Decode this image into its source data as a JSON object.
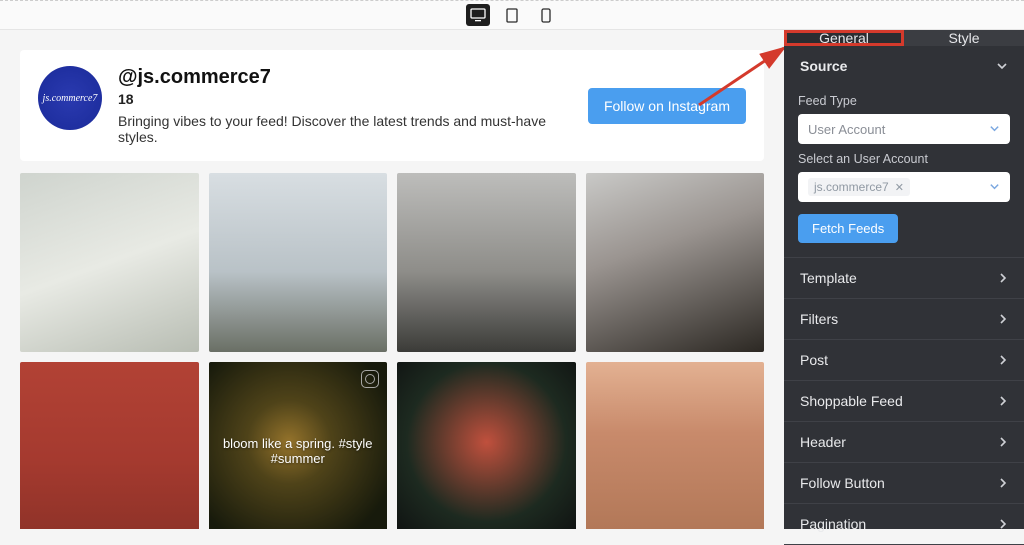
{
  "devices": [
    "desktop",
    "tablet",
    "mobile"
  ],
  "active_device": "desktop",
  "profile": {
    "avatar_text": "js.commerce7",
    "handle": "@js.commerce7",
    "posts_count": "18",
    "bio": "Bringing vibes to your feed! Discover the latest trends and must-have styles.",
    "follow_label": "Follow on Instagram"
  },
  "feed": {
    "items": [
      {
        "caption": ""
      },
      {
        "caption": ""
      },
      {
        "caption": ""
      },
      {
        "caption": ""
      },
      {
        "caption": ""
      },
      {
        "caption": "bloom like a spring. #style #summer",
        "show_icon": true
      },
      {
        "caption": ""
      },
      {
        "caption": ""
      }
    ]
  },
  "sidebar": {
    "tabs": {
      "general": "General",
      "style": "Style"
    },
    "active_tab": "general",
    "source": {
      "title": "Source",
      "feed_type_label": "Feed Type",
      "feed_type_value": "User Account",
      "select_account_label": "Select an User Account",
      "select_account_value": "js.commerce7",
      "fetch_label": "Fetch Feeds"
    },
    "sections": [
      "Template",
      "Filters",
      "Post",
      "Shoppable Feed",
      "Header",
      "Follow Button",
      "Pagination"
    ]
  },
  "colors": {
    "accent": "#4a9eef",
    "annotation": "#d43a2c",
    "sidebar_bg": "#303237"
  }
}
